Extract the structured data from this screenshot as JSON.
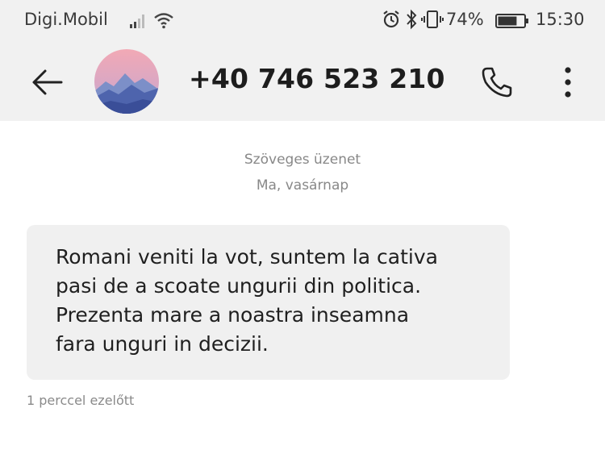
{
  "status_bar": {
    "carrier": "Digi.Mobil",
    "signal_icon": "signal-bars-icon",
    "wifi_icon": "wifi-icon",
    "alarm_icon": "alarm-clock-icon",
    "bluetooth_icon": "bluetooth-icon",
    "vibrate_icon": "vibrate-icon",
    "battery_percent": "74%",
    "battery_level": 0.74,
    "battery_icon": "battery-icon",
    "time": "15:30"
  },
  "app_bar": {
    "back_icon": "arrow-left-icon",
    "avatar_icon": "mountain-avatar",
    "contact": "+40 746 523 210",
    "call_icon": "phone-icon",
    "more_icon": "more-vertical-icon"
  },
  "conversation": {
    "message_type": "Szöveges üzenet",
    "date": "Ma, vasárnap",
    "message": {
      "text": "Romani veniti la vot, suntem la cativa\npasi de a scoate ungurii din politica.\nPrezenta mare a noastra inseamna\nfara unguri in decizii.",
      "timestamp": "1 perccel ezelőtt"
    }
  },
  "colors": {
    "bar_background": "#f1f1f1",
    "bubble_background": "#f0f0f0",
    "secondary_text": "#888888"
  }
}
